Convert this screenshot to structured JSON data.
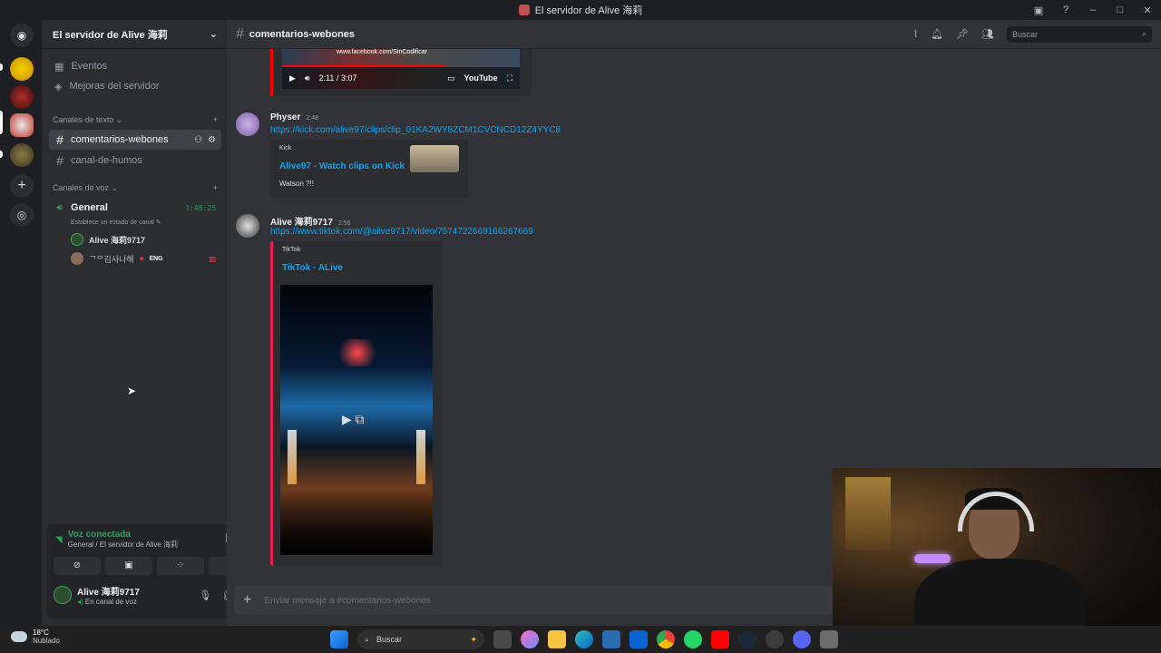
{
  "window": {
    "title": "El servidor de Alive 海莉"
  },
  "server": {
    "name": "El servidor de Alive 海莉"
  },
  "sidebar": {
    "top_items": [
      {
        "label": "Eventos",
        "icon": "calendar-icon"
      },
      {
        "label": "Mejoras del servidor",
        "icon": "boost-icon"
      }
    ],
    "text_category": "Canales de texto",
    "text_channels": [
      {
        "name": "comentarios-webones",
        "active": true
      },
      {
        "name": "canal-de-humos",
        "active": false
      }
    ],
    "voice_category": "Canales de voz",
    "voice_channel": {
      "name": "General",
      "timer": "1:48:25",
      "status_hint": "Establece un estado de canal"
    },
    "voice_users": [
      {
        "name": "Alive 海莉9717"
      },
      {
        "name": "ᄀᄋ김사나해",
        "badge": "ENG"
      }
    ]
  },
  "voice_panel": {
    "status": "Voz conectada",
    "location": "General / El servidor de Alive 海莉"
  },
  "user_panel": {
    "name": "Alive 海莉9717",
    "status": "En canal de voz"
  },
  "channel_header": {
    "name": "comentarios-webones",
    "search_placeholder": "Buscar"
  },
  "video_embed": {
    "watermark": "www.facebook.com/SinCodificar",
    "time": "2:11 / 3:07",
    "brand": "YouTube"
  },
  "messages": [
    {
      "author": "Physer",
      "time": "2:48",
      "link": "https://kick.com/alive97/clips/clip_01KA2WY8ZCM1CVCNCD12Z4YYC8",
      "embed": {
        "provider": "Kick",
        "title": "Alive97 - Watch clips on Kick",
        "description": "Watson ?!!"
      }
    },
    {
      "author": "Alive 海莉9717",
      "time": "2:56",
      "link": "https://www.tiktok.com/@alive9717/video/7574722669166267669",
      "embed": {
        "provider": "TikTok",
        "title": "TikTok · ALive"
      }
    }
  ],
  "composer": {
    "placeholder": "Enviar mensaje a #comentarios-webones"
  },
  "taskbar": {
    "weather_temp": "18°C",
    "weather_desc": "Nublado",
    "search_label": "Buscar"
  },
  "colors": {
    "accent": "#5865f2",
    "online": "#23a55a",
    "link": "#00a8fc",
    "tiktok_bar": "#ee1d52",
    "youtube_bar": "#ff0000"
  }
}
